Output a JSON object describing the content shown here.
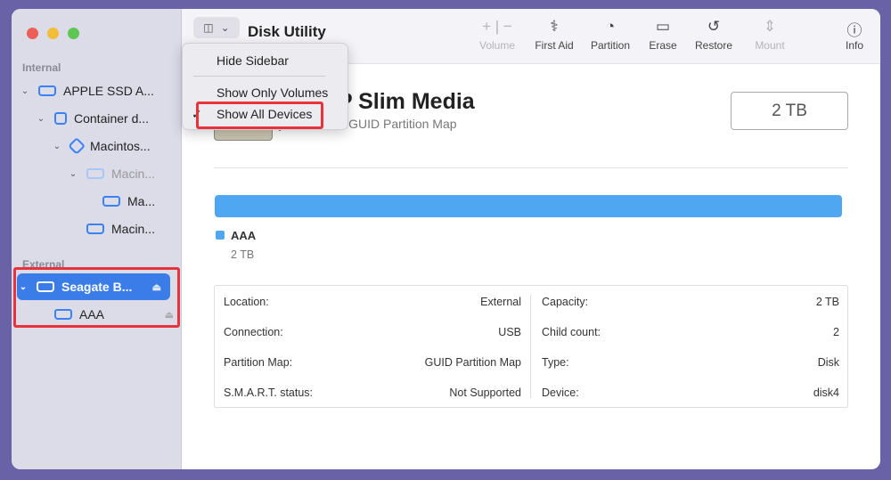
{
  "app": {
    "title": "Disk Utility"
  },
  "sidebar": {
    "internal_label": "Internal",
    "external_label": "External",
    "items": [
      {
        "label": "APPLE SSD A..."
      },
      {
        "label": "Container d..."
      },
      {
        "label": "Macintos..."
      },
      {
        "label": "Macin..."
      },
      {
        "label": "Ma..."
      },
      {
        "label": "Macin..."
      },
      {
        "label": "Seagate B..."
      },
      {
        "label": "AAA"
      }
    ]
  },
  "toolbar": {
    "volume": "Volume",
    "first_aid": "First Aid",
    "partition": "Partition",
    "erase": "Erase",
    "restore": "Restore",
    "mount": "Mount",
    "info": "Info"
  },
  "menu": {
    "hide_sidebar": "Hide Sidebar",
    "show_only_volumes": "Show Only Volumes",
    "show_all_devices": "Show All Devices",
    "checkmark": "✓"
  },
  "disk": {
    "title": "Seagate BUP Slim Media",
    "subtitle": "External Physical Disk • GUID Partition Map",
    "size": "2 TB",
    "volume": {
      "name": "AAA",
      "size": "2 TB",
      "color": "#4ea7f0",
      "used_fraction": 1.0
    }
  },
  "info": {
    "left": [
      {
        "k": "Location:",
        "v": "External"
      },
      {
        "k": "Connection:",
        "v": "USB"
      },
      {
        "k": "Partition Map:",
        "v": "GUID Partition Map"
      },
      {
        "k": "S.M.A.R.T. status:",
        "v": "Not Supported"
      }
    ],
    "right": [
      {
        "k": "Capacity:",
        "v": "2 TB"
      },
      {
        "k": "Child count:",
        "v": "2"
      },
      {
        "k": "Type:",
        "v": "Disk"
      },
      {
        "k": "Device:",
        "v": "disk4"
      }
    ]
  }
}
